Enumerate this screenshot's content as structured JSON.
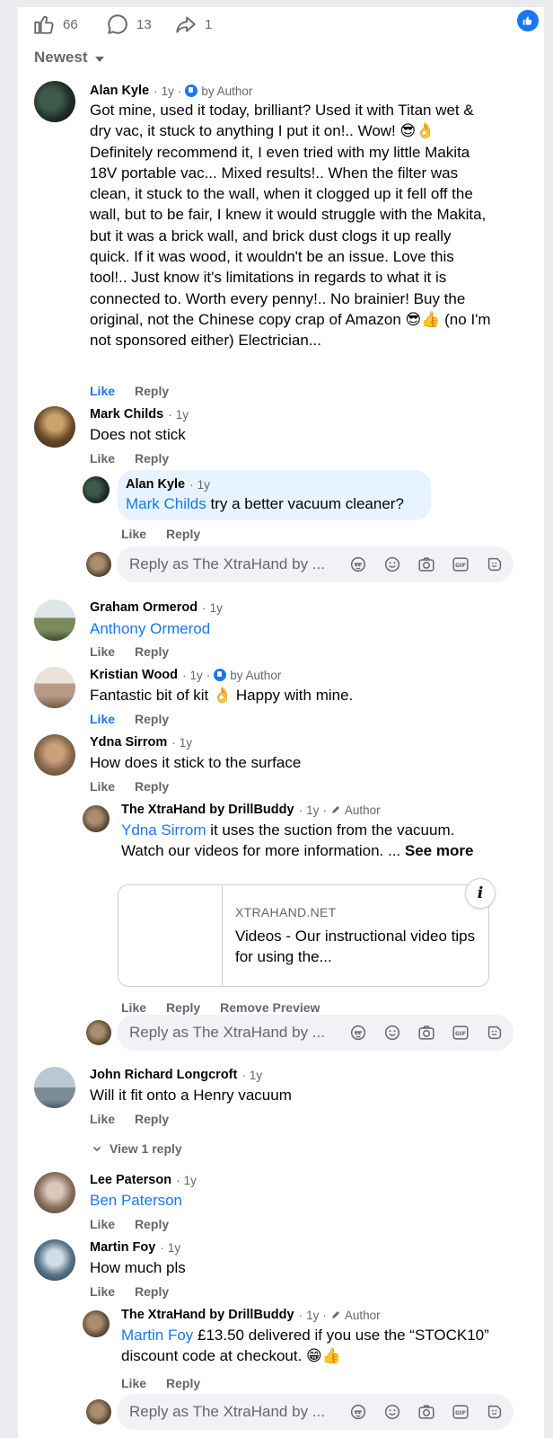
{
  "stats": {
    "likes": "66",
    "comments": "13",
    "shares": "1"
  },
  "sort": {
    "label": "Newest"
  },
  "placeholder": "Reply as The XtraHand by ...",
  "actions": {
    "like": "Like",
    "reply": "Reply",
    "remove_preview": "Remove Preview"
  },
  "comments": [
    {
      "name": "Alan Kyle",
      "time": "1y",
      "badge": "by Author",
      "text": "Got mine, used it today, brilliant? Used it with Titan wet & dry vac, it stuck to anything I put it on!.. Wow! 😎👌 Definitely recommend it, I even tried with my little Makita 18V portable vac... Mixed results!.. When the filter was clean, it stuck to the wall, when it clogged up it fell off the wall, but to be fair, I knew it would struggle with the Makita, but it was a brick wall, and brick dust clogs it up really quick. If it was wood, it wouldn't be an issue. Love this tool!.. Just know it's limitations in regards to what it is connected to. Worth every penny!.. No brainier! Buy the original, not the Chinese copy crap of Amazon 😎👍 (no I'm not sponsored either) Electrician..."
    },
    {
      "name": "Mark Childs",
      "time": "1y",
      "text": "Does not stick"
    },
    {
      "name": "Alan Kyle",
      "time": "1y",
      "mention": "Mark Childs",
      "text": " try a better vacuum cleaner?"
    },
    {
      "name": "Graham Ormerod",
      "time": "1y",
      "mention": "Anthony Ormerod"
    },
    {
      "name": "Kristian Wood",
      "time": "1y",
      "badge": "by Author",
      "text": "Fantastic bit of kit 👌 Happy with mine."
    },
    {
      "name": "Ydna Sirrom",
      "time": "1y",
      "text": "How does it stick to the surface"
    },
    {
      "name": "The XtraHand by DrillBuddy",
      "time": "1y",
      "badge": "Author",
      "mention": "Ydna Sirrom",
      "text": " it uses the suction from the vacuum. Watch our videos for more information. ... ",
      "see_more": "See more"
    },
    {
      "name": "John Richard Longcroft",
      "time": "1y",
      "text": "Will it fit onto a Henry vacuum"
    },
    {
      "name": "Lee Paterson",
      "time": "1y",
      "mention": "Ben Paterson"
    },
    {
      "name": "Martin Foy",
      "time": "1y",
      "text": "How much pls"
    },
    {
      "name": "The XtraHand by DrillBuddy",
      "time": "1y",
      "badge": "Author",
      "mention": "Martin Foy",
      "text": " £13.50 delivered if you use the “STOCK10” discount code at checkout. 😁👍"
    }
  ],
  "link_preview": {
    "domain": "XTRAHAND.NET",
    "title": "Videos - Our instructional video tips for using the..."
  },
  "view_replies": "View 1 reply",
  "colors": {
    "accent": "#1877f2",
    "secondary_text": "#65676b",
    "bubble": "#e7f3ff",
    "input_bg": "#f0f2f5"
  }
}
